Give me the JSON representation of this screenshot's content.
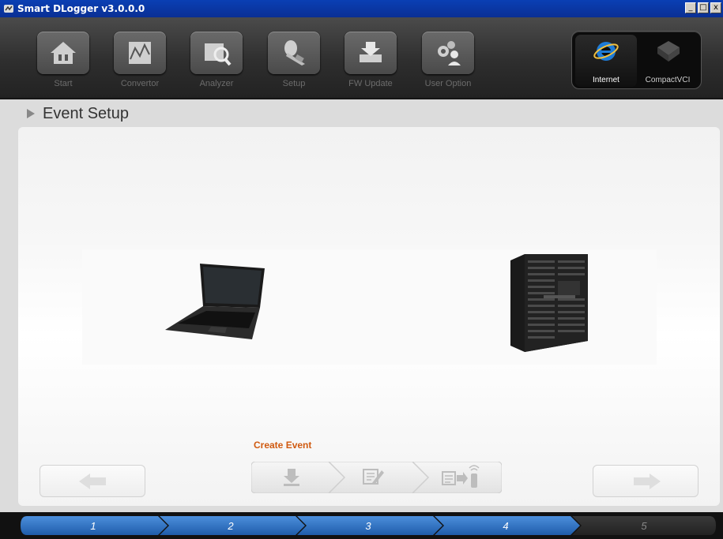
{
  "window": {
    "title": "Smart DLogger v3.0.0.0",
    "controls": [
      "_",
      "□",
      "x"
    ]
  },
  "toolbar": {
    "items": [
      {
        "label": "Start",
        "icon": "home-icon"
      },
      {
        "label": "Convertor",
        "icon": "convertor-icon"
      },
      {
        "label": "Analyzer",
        "icon": "analyzer-icon"
      },
      {
        "label": "Setup",
        "icon": "setup-icon"
      },
      {
        "label": "FW Update",
        "icon": "fw-update-icon"
      },
      {
        "label": "User Option",
        "icon": "user-option-icon"
      }
    ],
    "external": [
      {
        "label": "Internet",
        "icon": "internet-explorer-icon",
        "active": true
      },
      {
        "label": "CompactVCI",
        "icon": "compactvci-icon",
        "active": false
      }
    ]
  },
  "section": {
    "title": "Event Setup"
  },
  "stage": {
    "left_device": "laptop-image",
    "right_device": "server-rack-image"
  },
  "actions": {
    "create_label": "Create Event",
    "steps": [
      "download-icon",
      "edit-icon",
      "transfer-icon"
    ],
    "prev_icon": "arrow-left-icon",
    "next_icon": "arrow-right-icon"
  },
  "progress": {
    "steps": [
      "1",
      "2",
      "3",
      "4",
      "5"
    ],
    "completed": 4
  },
  "colors": {
    "accent_blue": "#2f73c6",
    "create_label": "#d05a10",
    "titlebar": "#0a3fb4"
  }
}
